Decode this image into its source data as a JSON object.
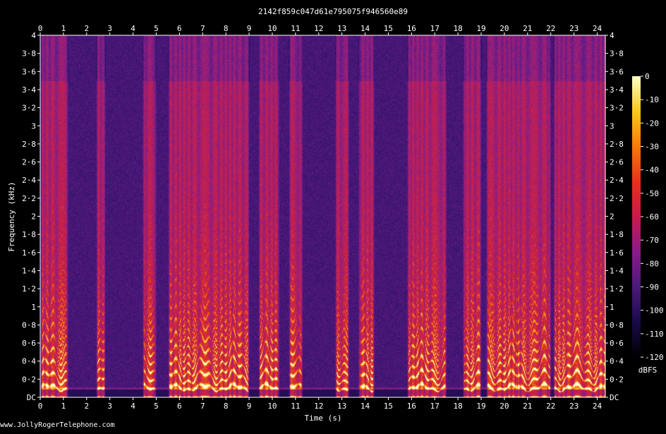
{
  "watermark": "www.JollyRogerTelephone.com",
  "chart_data": {
    "type": "heatmap",
    "title": "2142f859c047d61e795075f946560e89",
    "xlabel": "Time (s)",
    "ylabel": "Frequency (kHz)",
    "xlim": [
      0,
      24.35
    ],
    "ylim": [
      0,
      4
    ],
    "x_ticks": [
      0,
      1,
      2,
      3,
      4,
      5,
      6,
      7,
      8,
      9,
      10,
      11,
      12,
      13,
      14,
      15,
      16,
      17,
      18,
      19,
      20,
      21,
      22,
      23,
      24
    ],
    "y_ticks": [
      {
        "value": 0,
        "label": "DC"
      },
      {
        "value": 0.2,
        "label": "0·2"
      },
      {
        "value": 0.4,
        "label": "0·4"
      },
      {
        "value": 0.6,
        "label": "0·6"
      },
      {
        "value": 0.8,
        "label": "0·8"
      },
      {
        "value": 1,
        "label": "1"
      },
      {
        "value": 1.2,
        "label": "1·2"
      },
      {
        "value": 1.4,
        "label": "1·4"
      },
      {
        "value": 1.6,
        "label": "1·6"
      },
      {
        "value": 1.8,
        "label": "1·8"
      },
      {
        "value": 2,
        "label": "2"
      },
      {
        "value": 2.2,
        "label": "2·2"
      },
      {
        "value": 2.4,
        "label": "2·4"
      },
      {
        "value": 2.6,
        "label": "2·6"
      },
      {
        "value": 2.8,
        "label": "2·8"
      },
      {
        "value": 3,
        "label": "3"
      },
      {
        "value": 3.2,
        "label": "3·2"
      },
      {
        "value": 3.4,
        "label": "3·4"
      },
      {
        "value": 3.6,
        "label": "3·6"
      },
      {
        "value": 3.8,
        "label": "3·8"
      },
      {
        "value": 4,
        "label": "4"
      }
    ],
    "colorbar": {
      "label": "dBFS",
      "range": [
        -120,
        0
      ],
      "ticks": [
        0,
        -10,
        -20,
        -30,
        -40,
        -50,
        -60,
        -70,
        -80,
        -90,
        -100,
        -110,
        -120
      ],
      "colors": [
        "#000000",
        "#1a0a4a",
        "#4a1a7a",
        "#8a1a8a",
        "#c81a4a",
        "#e8301a",
        "#f87a0a",
        "#f8c81a",
        "#ffffc8"
      ]
    },
    "speech_segments_s": [
      [
        0.0,
        1.2
      ],
      [
        2.4,
        2.8
      ],
      [
        4.4,
        5.0
      ],
      [
        5.5,
        8.1
      ],
      [
        7.8,
        9.0
      ],
      [
        9.4,
        10.3
      ],
      [
        10.7,
        11.3
      ],
      [
        12.7,
        13.3
      ],
      [
        13.7,
        14.4
      ],
      [
        15.8,
        17.5
      ],
      [
        18.2,
        19.0
      ],
      [
        19.2,
        20.6
      ],
      [
        20.5,
        22.0
      ],
      [
        22.1,
        24.4
      ]
    ]
  }
}
